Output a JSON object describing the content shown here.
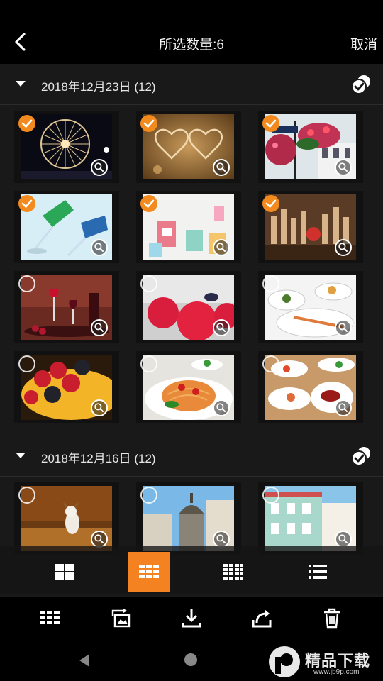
{
  "header": {
    "title": "所选数量:6",
    "cancel_label": "取消"
  },
  "sections": [
    {
      "date": "2018年12月23日 (12)",
      "photos": [
        {
          "subject": "ferris-wheel",
          "checked": true
        },
        {
          "subject": "heart-ornament",
          "checked": true
        },
        {
          "subject": "street-sign-flowers",
          "checked": true
        },
        {
          "subject": "glass-bottles",
          "checked": true
        },
        {
          "subject": "candles",
          "checked": true
        },
        {
          "subject": "bottle-collection",
          "checked": true
        },
        {
          "subject": "wine-glasses",
          "checked": false
        },
        {
          "subject": "raspberries",
          "checked": false
        },
        {
          "subject": "seafood-plates",
          "checked": false
        },
        {
          "subject": "berry-tart",
          "checked": false
        },
        {
          "subject": "spaghetti",
          "checked": false
        },
        {
          "subject": "appetizer-plates",
          "checked": false
        }
      ]
    },
    {
      "date": "2018年12月16日 (12)",
      "photos": [
        {
          "subject": "dog-autumn",
          "checked": false
        },
        {
          "subject": "dome-building",
          "checked": false
        },
        {
          "subject": "pastel-building",
          "checked": false
        }
      ]
    }
  ],
  "view_modes": [
    "grid-2-icon",
    "grid-3-icon",
    "grid-4-icon",
    "list-icon"
  ],
  "active_view": 1,
  "toolbar_icons": [
    "grid-icon",
    "slideshow-icon",
    "download-icon",
    "share-icon",
    "trash-icon"
  ],
  "watermark": {
    "text": "精品下载",
    "sub": "www.jb9p.com"
  },
  "colors": {
    "accent": "#f58220",
    "background": "#191919"
  }
}
